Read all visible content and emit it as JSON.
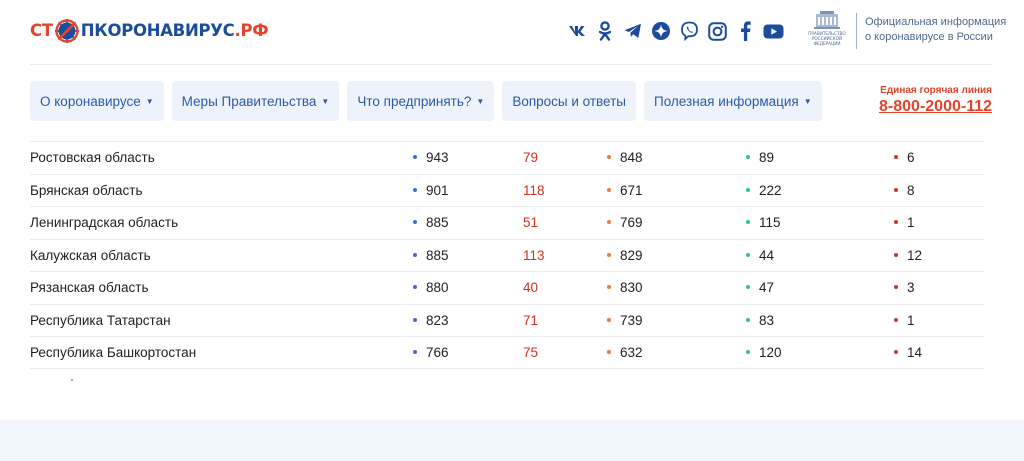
{
  "header": {
    "logo": {
      "stop": "СТ",
      "word": "ПКОРОНАВИРУС",
      "rf": ".РФ"
    },
    "socials": [
      {
        "name": "vk",
        "icon": "vk-icon"
      },
      {
        "name": "odnoklassniki",
        "icon": "odnoklassniki-icon"
      },
      {
        "name": "telegram",
        "icon": "telegram-icon"
      },
      {
        "name": "yandex-zen",
        "icon": "zen-icon"
      },
      {
        "name": "viber",
        "icon": "viber-icon"
      },
      {
        "name": "instagram",
        "icon": "instagram-icon"
      },
      {
        "name": "facebook",
        "icon": "facebook-icon"
      },
      {
        "name": "youtube",
        "icon": "youtube-icon"
      }
    ],
    "gov": {
      "emblem_text": [
        "ПРАВИТЕЛЬСТВО",
        "РОССИЙСКОЙ",
        "ФЕДЕРАЦИИ"
      ],
      "line1": "Официальная информация",
      "line2": "о коронавирусе в России"
    }
  },
  "nav": {
    "items": [
      {
        "label": "О коронавирусе",
        "caret": "▼"
      },
      {
        "label": "Меры Правительства",
        "caret": "▼"
      },
      {
        "label": "Что предпринять?",
        "caret": "▼"
      },
      {
        "label": "Вопросы и ответы",
        "caret": ""
      },
      {
        "label": "Полезная информация",
        "caret": "▼"
      }
    ]
  },
  "hotline": {
    "label": "Единая горячая линия",
    "phone": "8-800-2000-112"
  },
  "colors": {
    "total": "#3a6ee0",
    "recovered": "#f07a4a",
    "active": "#2cc4a8",
    "dead": "#d0301e",
    "new": "#d0301e"
  },
  "table": {
    "rows": [
      {
        "region": "Ростовская область",
        "total": "943",
        "new": "79",
        "recovered": "848",
        "active": "89",
        "dead": "6"
      },
      {
        "region": "Брянская область",
        "total": "901",
        "new": "118",
        "recovered": "671",
        "active": "222",
        "dead": "8"
      },
      {
        "region": "Ленинградская область",
        "total": "885",
        "new": "51",
        "recovered": "769",
        "active": "115",
        "dead": "1"
      },
      {
        "region": "Калужская область",
        "total": "885",
        "new": "113",
        "recovered": "829",
        "active": "44",
        "dead": "12"
      },
      {
        "region": "Рязанская область",
        "total": "880",
        "new": "40",
        "recovered": "830",
        "active": "47",
        "dead": "3"
      },
      {
        "region": "Республика Татарстан",
        "total": "823",
        "new": "71",
        "recovered": "739",
        "active": "83",
        "dead": "1"
      },
      {
        "region": "Республика Башкортостан",
        "total": "766",
        "new": "75",
        "recovered": "632",
        "active": "120",
        "dead": "14"
      }
    ]
  }
}
